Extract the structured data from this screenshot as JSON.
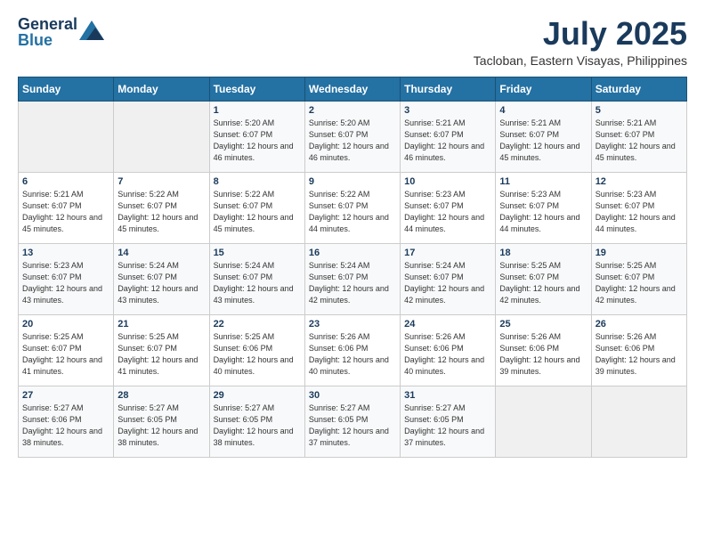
{
  "header": {
    "logo_general": "General",
    "logo_blue": "Blue",
    "month_year": "July 2025",
    "location": "Tacloban, Eastern Visayas, Philippines"
  },
  "weekdays": [
    "Sunday",
    "Monday",
    "Tuesday",
    "Wednesday",
    "Thursday",
    "Friday",
    "Saturday"
  ],
  "weeks": [
    [
      {
        "day": "",
        "sunrise": "",
        "sunset": "",
        "daylight": ""
      },
      {
        "day": "",
        "sunrise": "",
        "sunset": "",
        "daylight": ""
      },
      {
        "day": "1",
        "sunrise": "Sunrise: 5:20 AM",
        "sunset": "Sunset: 6:07 PM",
        "daylight": "Daylight: 12 hours and 46 minutes."
      },
      {
        "day": "2",
        "sunrise": "Sunrise: 5:20 AM",
        "sunset": "Sunset: 6:07 PM",
        "daylight": "Daylight: 12 hours and 46 minutes."
      },
      {
        "day": "3",
        "sunrise": "Sunrise: 5:21 AM",
        "sunset": "Sunset: 6:07 PM",
        "daylight": "Daylight: 12 hours and 46 minutes."
      },
      {
        "day": "4",
        "sunrise": "Sunrise: 5:21 AM",
        "sunset": "Sunset: 6:07 PM",
        "daylight": "Daylight: 12 hours and 45 minutes."
      },
      {
        "day": "5",
        "sunrise": "Sunrise: 5:21 AM",
        "sunset": "Sunset: 6:07 PM",
        "daylight": "Daylight: 12 hours and 45 minutes."
      }
    ],
    [
      {
        "day": "6",
        "sunrise": "Sunrise: 5:21 AM",
        "sunset": "Sunset: 6:07 PM",
        "daylight": "Daylight: 12 hours and 45 minutes."
      },
      {
        "day": "7",
        "sunrise": "Sunrise: 5:22 AM",
        "sunset": "Sunset: 6:07 PM",
        "daylight": "Daylight: 12 hours and 45 minutes."
      },
      {
        "day": "8",
        "sunrise": "Sunrise: 5:22 AM",
        "sunset": "Sunset: 6:07 PM",
        "daylight": "Daylight: 12 hours and 45 minutes."
      },
      {
        "day": "9",
        "sunrise": "Sunrise: 5:22 AM",
        "sunset": "Sunset: 6:07 PM",
        "daylight": "Daylight: 12 hours and 44 minutes."
      },
      {
        "day": "10",
        "sunrise": "Sunrise: 5:23 AM",
        "sunset": "Sunset: 6:07 PM",
        "daylight": "Daylight: 12 hours and 44 minutes."
      },
      {
        "day": "11",
        "sunrise": "Sunrise: 5:23 AM",
        "sunset": "Sunset: 6:07 PM",
        "daylight": "Daylight: 12 hours and 44 minutes."
      },
      {
        "day": "12",
        "sunrise": "Sunrise: 5:23 AM",
        "sunset": "Sunset: 6:07 PM",
        "daylight": "Daylight: 12 hours and 44 minutes."
      }
    ],
    [
      {
        "day": "13",
        "sunrise": "Sunrise: 5:23 AM",
        "sunset": "Sunset: 6:07 PM",
        "daylight": "Daylight: 12 hours and 43 minutes."
      },
      {
        "day": "14",
        "sunrise": "Sunrise: 5:24 AM",
        "sunset": "Sunset: 6:07 PM",
        "daylight": "Daylight: 12 hours and 43 minutes."
      },
      {
        "day": "15",
        "sunrise": "Sunrise: 5:24 AM",
        "sunset": "Sunset: 6:07 PM",
        "daylight": "Daylight: 12 hours and 43 minutes."
      },
      {
        "day": "16",
        "sunrise": "Sunrise: 5:24 AM",
        "sunset": "Sunset: 6:07 PM",
        "daylight": "Daylight: 12 hours and 42 minutes."
      },
      {
        "day": "17",
        "sunrise": "Sunrise: 5:24 AM",
        "sunset": "Sunset: 6:07 PM",
        "daylight": "Daylight: 12 hours and 42 minutes."
      },
      {
        "day": "18",
        "sunrise": "Sunrise: 5:25 AM",
        "sunset": "Sunset: 6:07 PM",
        "daylight": "Daylight: 12 hours and 42 minutes."
      },
      {
        "day": "19",
        "sunrise": "Sunrise: 5:25 AM",
        "sunset": "Sunset: 6:07 PM",
        "daylight": "Daylight: 12 hours and 42 minutes."
      }
    ],
    [
      {
        "day": "20",
        "sunrise": "Sunrise: 5:25 AM",
        "sunset": "Sunset: 6:07 PM",
        "daylight": "Daylight: 12 hours and 41 minutes."
      },
      {
        "day": "21",
        "sunrise": "Sunrise: 5:25 AM",
        "sunset": "Sunset: 6:07 PM",
        "daylight": "Daylight: 12 hours and 41 minutes."
      },
      {
        "day": "22",
        "sunrise": "Sunrise: 5:25 AM",
        "sunset": "Sunset: 6:06 PM",
        "daylight": "Daylight: 12 hours and 40 minutes."
      },
      {
        "day": "23",
        "sunrise": "Sunrise: 5:26 AM",
        "sunset": "Sunset: 6:06 PM",
        "daylight": "Daylight: 12 hours and 40 minutes."
      },
      {
        "day": "24",
        "sunrise": "Sunrise: 5:26 AM",
        "sunset": "Sunset: 6:06 PM",
        "daylight": "Daylight: 12 hours and 40 minutes."
      },
      {
        "day": "25",
        "sunrise": "Sunrise: 5:26 AM",
        "sunset": "Sunset: 6:06 PM",
        "daylight": "Daylight: 12 hours and 39 minutes."
      },
      {
        "day": "26",
        "sunrise": "Sunrise: 5:26 AM",
        "sunset": "Sunset: 6:06 PM",
        "daylight": "Daylight: 12 hours and 39 minutes."
      }
    ],
    [
      {
        "day": "27",
        "sunrise": "Sunrise: 5:27 AM",
        "sunset": "Sunset: 6:06 PM",
        "daylight": "Daylight: 12 hours and 38 minutes."
      },
      {
        "day": "28",
        "sunrise": "Sunrise: 5:27 AM",
        "sunset": "Sunset: 6:05 PM",
        "daylight": "Daylight: 12 hours and 38 minutes."
      },
      {
        "day": "29",
        "sunrise": "Sunrise: 5:27 AM",
        "sunset": "Sunset: 6:05 PM",
        "daylight": "Daylight: 12 hours and 38 minutes."
      },
      {
        "day": "30",
        "sunrise": "Sunrise: 5:27 AM",
        "sunset": "Sunset: 6:05 PM",
        "daylight": "Daylight: 12 hours and 37 minutes."
      },
      {
        "day": "31",
        "sunrise": "Sunrise: 5:27 AM",
        "sunset": "Sunset: 6:05 PM",
        "daylight": "Daylight: 12 hours and 37 minutes."
      },
      {
        "day": "",
        "sunrise": "",
        "sunset": "",
        "daylight": ""
      },
      {
        "day": "",
        "sunrise": "",
        "sunset": "",
        "daylight": ""
      }
    ]
  ]
}
